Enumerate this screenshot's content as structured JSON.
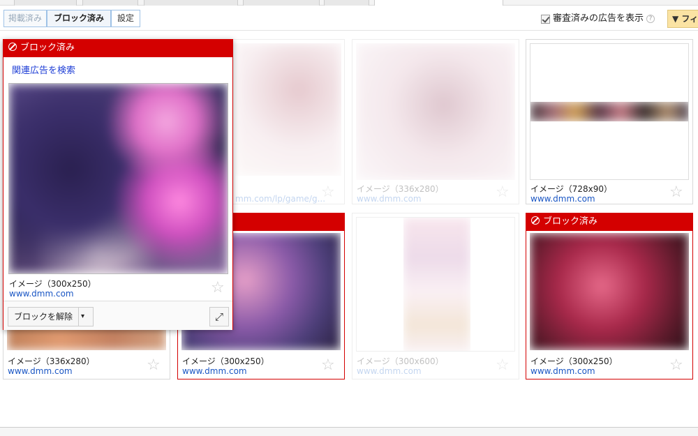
{
  "tabs": {
    "published": "掲載済み",
    "blocked": "ブロック済み",
    "settings": "設定"
  },
  "show_reviewed": {
    "label": "審査済みの広告を表示",
    "checked": true,
    "help": "?"
  },
  "filter_button": "▼ フィ",
  "blocked_label": "ブロック済み",
  "popup": {
    "header": "ブロック済み",
    "related_search": "関連広告を検索",
    "title": "イメージ（300x250）",
    "url": "www.dmm.com",
    "unblock_label": "ブロックを解除",
    "dropdown_icon": "▾",
    "expand_icon": "⤢"
  },
  "cards": [
    {
      "title": "",
      "url": "",
      "blocked": false,
      "faded": true
    },
    {
      "title": "",
      "url": "mm.com/lp/game/g...",
      "blocked": false,
      "faded": true
    },
    {
      "title": "イメージ（336x280）",
      "url": "www.dmm.com",
      "blocked": false,
      "faded": true
    },
    {
      "title": "イメージ（728x90）",
      "url": "www.dmm.com",
      "blocked": false,
      "faded": false
    },
    {
      "title": "イメージ（336x280）",
      "url": "www.dmm.com",
      "blocked": false,
      "faded": false
    },
    {
      "title": "イメージ（300x250）",
      "url": "www.dmm.com",
      "blocked": true,
      "header": "済み",
      "faded": false
    },
    {
      "title": "イメージ（300x600）",
      "url": "www.dmm.com",
      "blocked": false,
      "faded": true
    },
    {
      "title": "イメージ（300x250）",
      "url": "www.dmm.com",
      "blocked": true,
      "header": "ブロック済み",
      "faded": false
    }
  ],
  "star_icon": "☆"
}
